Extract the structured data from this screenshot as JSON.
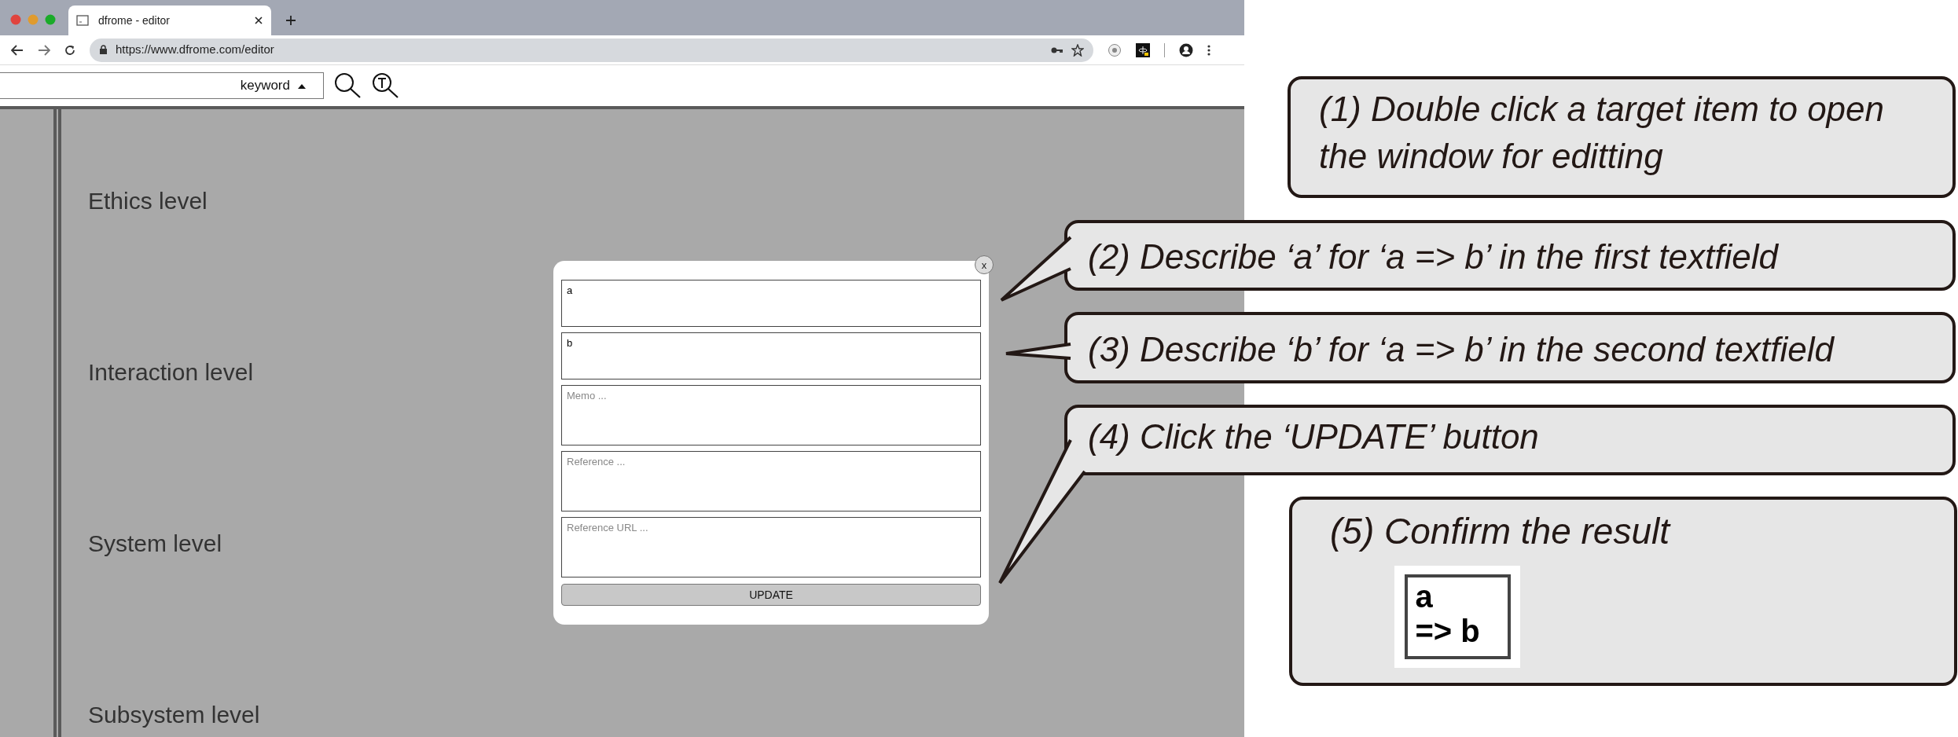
{
  "browser": {
    "tab_title": "dfrome - editor",
    "url": "https://www.dfrome.com/editor"
  },
  "toolbar": {
    "sort_label": "keyword"
  },
  "levels": [
    "Ethics level",
    "Interaction level",
    "System level",
    "Subsystem level"
  ],
  "modal": {
    "close": "x",
    "fields": [
      {
        "value": "a"
      },
      {
        "value": "b"
      },
      {
        "placeholder": "Memo ..."
      },
      {
        "placeholder": "Reference ..."
      },
      {
        "placeholder": "Reference URL ..."
      }
    ],
    "button": "UPDATE"
  },
  "callouts": [
    {
      "text": "(1) Double click a target item to open the window for editting"
    },
    {
      "text": "(2) Describe ‘a’ for ‘a => b’ in the first textfield"
    },
    {
      "text": "(3) Describe ‘b’ for ‘a => b’ in the second textfield"
    },
    {
      "text": "(4) Click the ‘UPDATE’ button"
    },
    {
      "text": "(5) Confirm the result",
      "result": [
        "a",
        "=> b"
      ]
    }
  ]
}
